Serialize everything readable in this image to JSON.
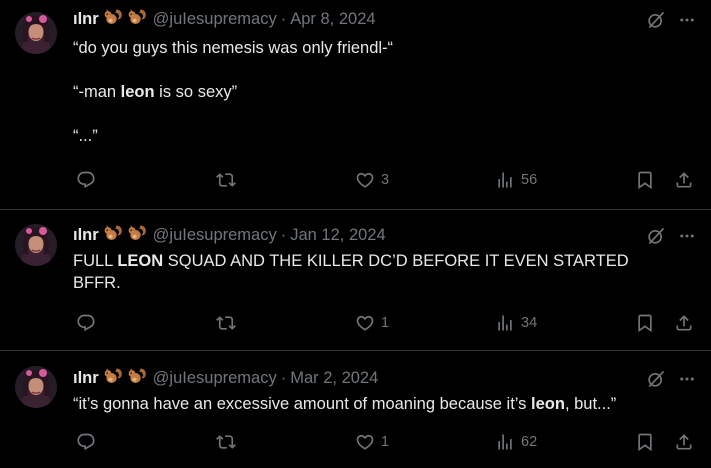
{
  "tweets": [
    {
      "user": {
        "name": "ılnr",
        "handle": "@juIesupremacy"
      },
      "sep": "·",
      "date": "Apr 8, 2024",
      "lines": [
        "“do you guys this nemesis was only friendl-“",
        "",
        "“-man ",
        "leon",
        " is so sexy”",
        "",
        "“...”"
      ],
      "stats": {
        "replies": "",
        "reposts": "",
        "likes": "3",
        "views": "56"
      }
    },
    {
      "user": {
        "name": "ılnr",
        "handle": "@juIesupremacy"
      },
      "sep": "·",
      "date": "Jan 12, 2024",
      "lines": [
        "FULL ",
        "LEON",
        " SQUAD AND THE KILLER DC’D BEFORE IT EVEN STARTED BFFR."
      ],
      "stats": {
        "replies": "",
        "reposts": "",
        "likes": "1",
        "views": "34"
      }
    },
    {
      "user": {
        "name": "ılnr",
        "handle": "@juIesupremacy"
      },
      "sep": "·",
      "date": "Mar 2, 2024",
      "lines": [
        "“it’s gonna have an excessive amount of moaning because it’s ",
        "leon",
        ", but...”"
      ],
      "stats": {
        "replies": "",
        "reposts": "",
        "likes": "1",
        "views": "62"
      }
    }
  ],
  "icons": {
    "emoji": "squirrel-emoji",
    "grok": "grok-icon",
    "more": "more-icon",
    "reply": "reply-icon",
    "repost": "repost-icon",
    "like": "heart-icon",
    "views": "views-icon",
    "bookmark": "bookmark-icon",
    "share": "share-icon"
  },
  "colors": {
    "background": "#000000",
    "text": "#e7e9ea",
    "muted": "#71767b",
    "divider": "#2f3336"
  }
}
